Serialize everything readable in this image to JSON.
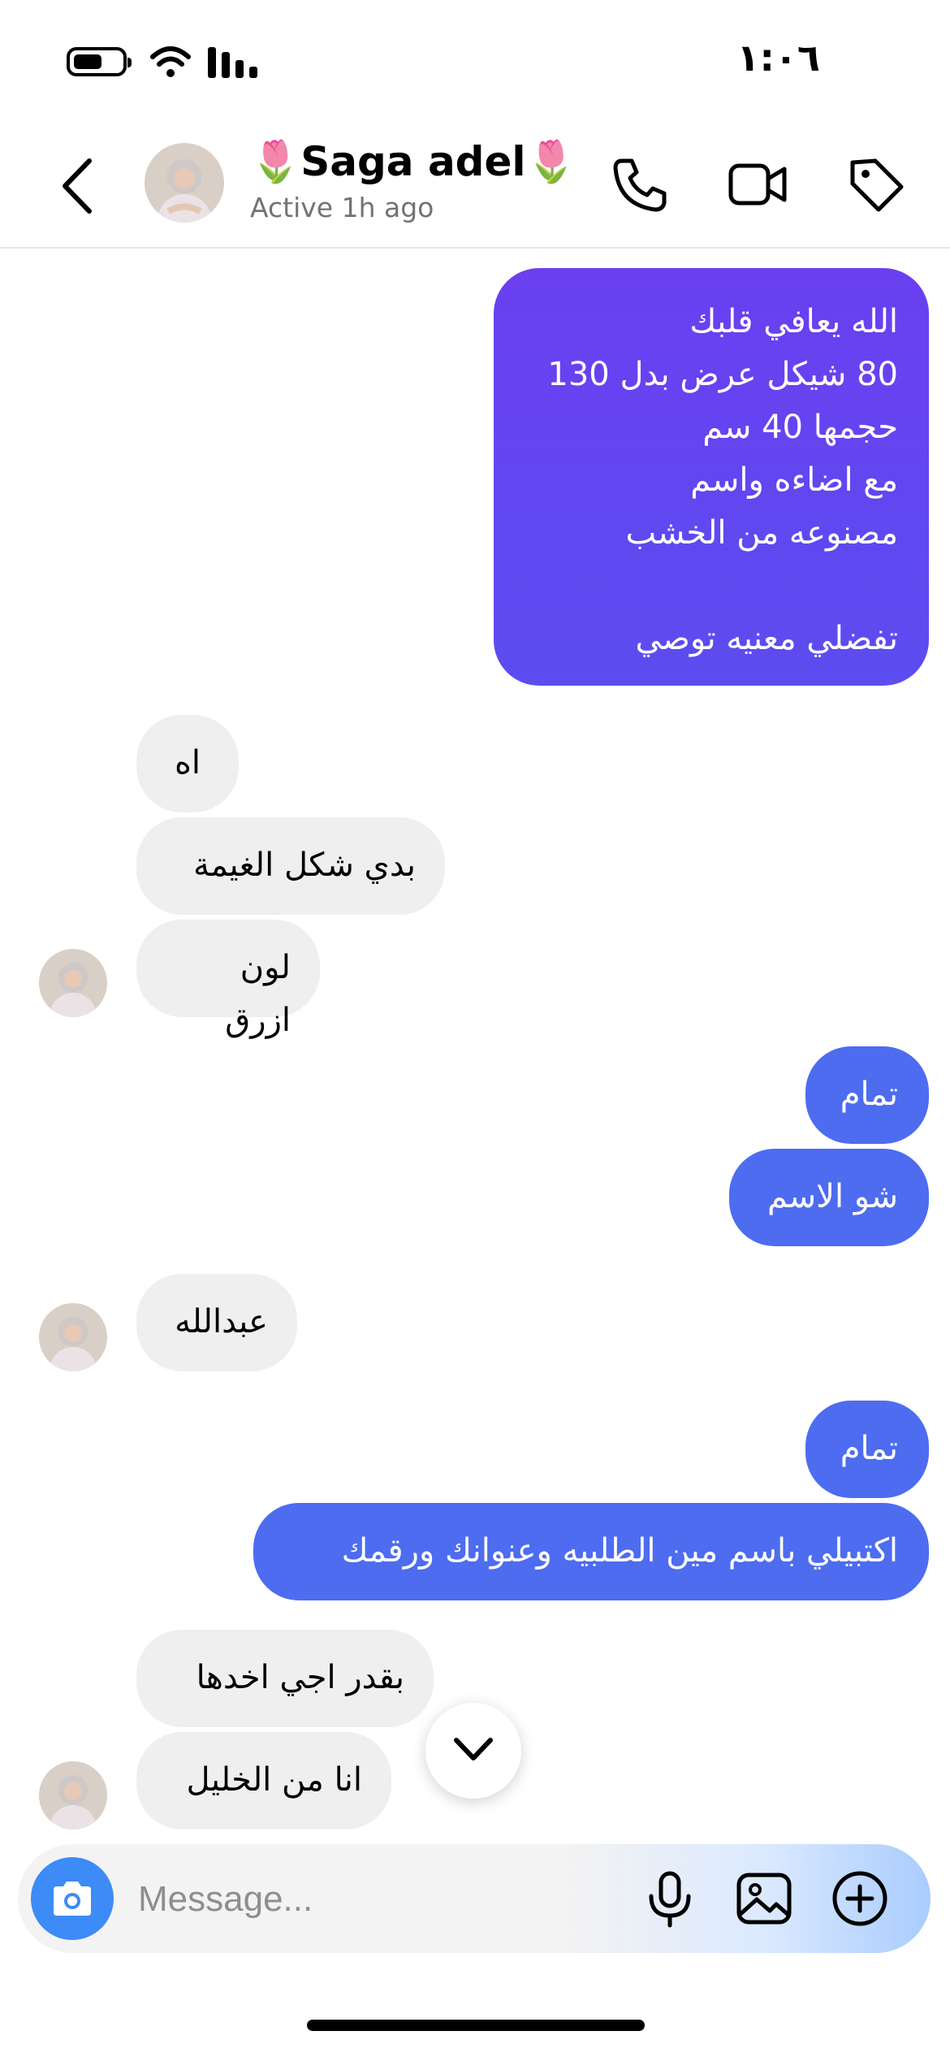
{
  "status_bar": {
    "time": "١:٠٦"
  },
  "header": {
    "contact_name": "🌷Saga adel🌷",
    "active_status": "Active 1h ago",
    "icons": [
      "back-arrow-icon",
      "phone-icon",
      "video-camera-icon",
      "tag-icon"
    ]
  },
  "messages": [
    {
      "direction": "sent",
      "text": "الله يعافي قلبك\n80 شيكل عرض بدل 130\nحجمها 40 سم\nمع اضاءه واسم\nمصنوعه من الخشب\n\nتفضلي معنيه توصي"
    },
    {
      "direction": "received",
      "text": "اه"
    },
    {
      "direction": "received",
      "text": "بدي شكل الغيمة"
    },
    {
      "direction": "received",
      "text": "لون ازرق"
    },
    {
      "direction": "sent",
      "text": "تمام"
    },
    {
      "direction": "sent",
      "text": "شو الاسم"
    },
    {
      "direction": "received",
      "text": "عبدالله"
    },
    {
      "direction": "sent",
      "text": "تمام"
    },
    {
      "direction": "sent",
      "text": "اكتبيلي باسم مين الطلبيه وعنوانك ورقمك"
    },
    {
      "direction": "received",
      "text": "بقدر اجي اخدها"
    },
    {
      "direction": "received",
      "text": "انا من الخليل"
    }
  ],
  "composer": {
    "placeholder": "Message...",
    "value": "",
    "icons": [
      "camera-icon",
      "microphone-icon",
      "gallery-icon",
      "plus-icon"
    ]
  },
  "colors": {
    "sent_bubble": "#4d6cf0",
    "sent_bubble_gradient_top": "#6a3ff0",
    "received_bubble": "#efefef",
    "camera_button": "#3d8bf6"
  }
}
